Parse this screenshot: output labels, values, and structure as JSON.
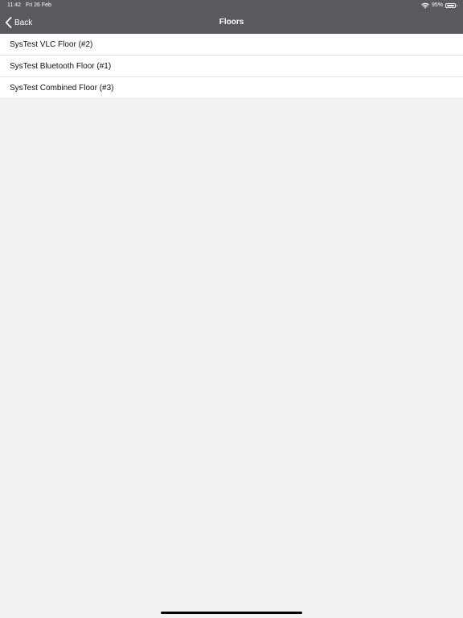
{
  "status_bar": {
    "time": "11:42",
    "date": "Fri 26 Feb",
    "battery_percent_text": "95%",
    "battery_level": 0.95
  },
  "nav": {
    "back_label": "Back",
    "title": "Floors"
  },
  "floors": [
    {
      "label": "SysTest VLC Floor (#2)"
    },
    {
      "label": "SysTest Bluetooth Floor (#1)"
    },
    {
      "label": "SysTest Combined Floor (#3)"
    }
  ],
  "colors": {
    "nav_background": "#5a5a5e",
    "page_background": "#f2f2f2",
    "row_background": "#ffffff"
  }
}
